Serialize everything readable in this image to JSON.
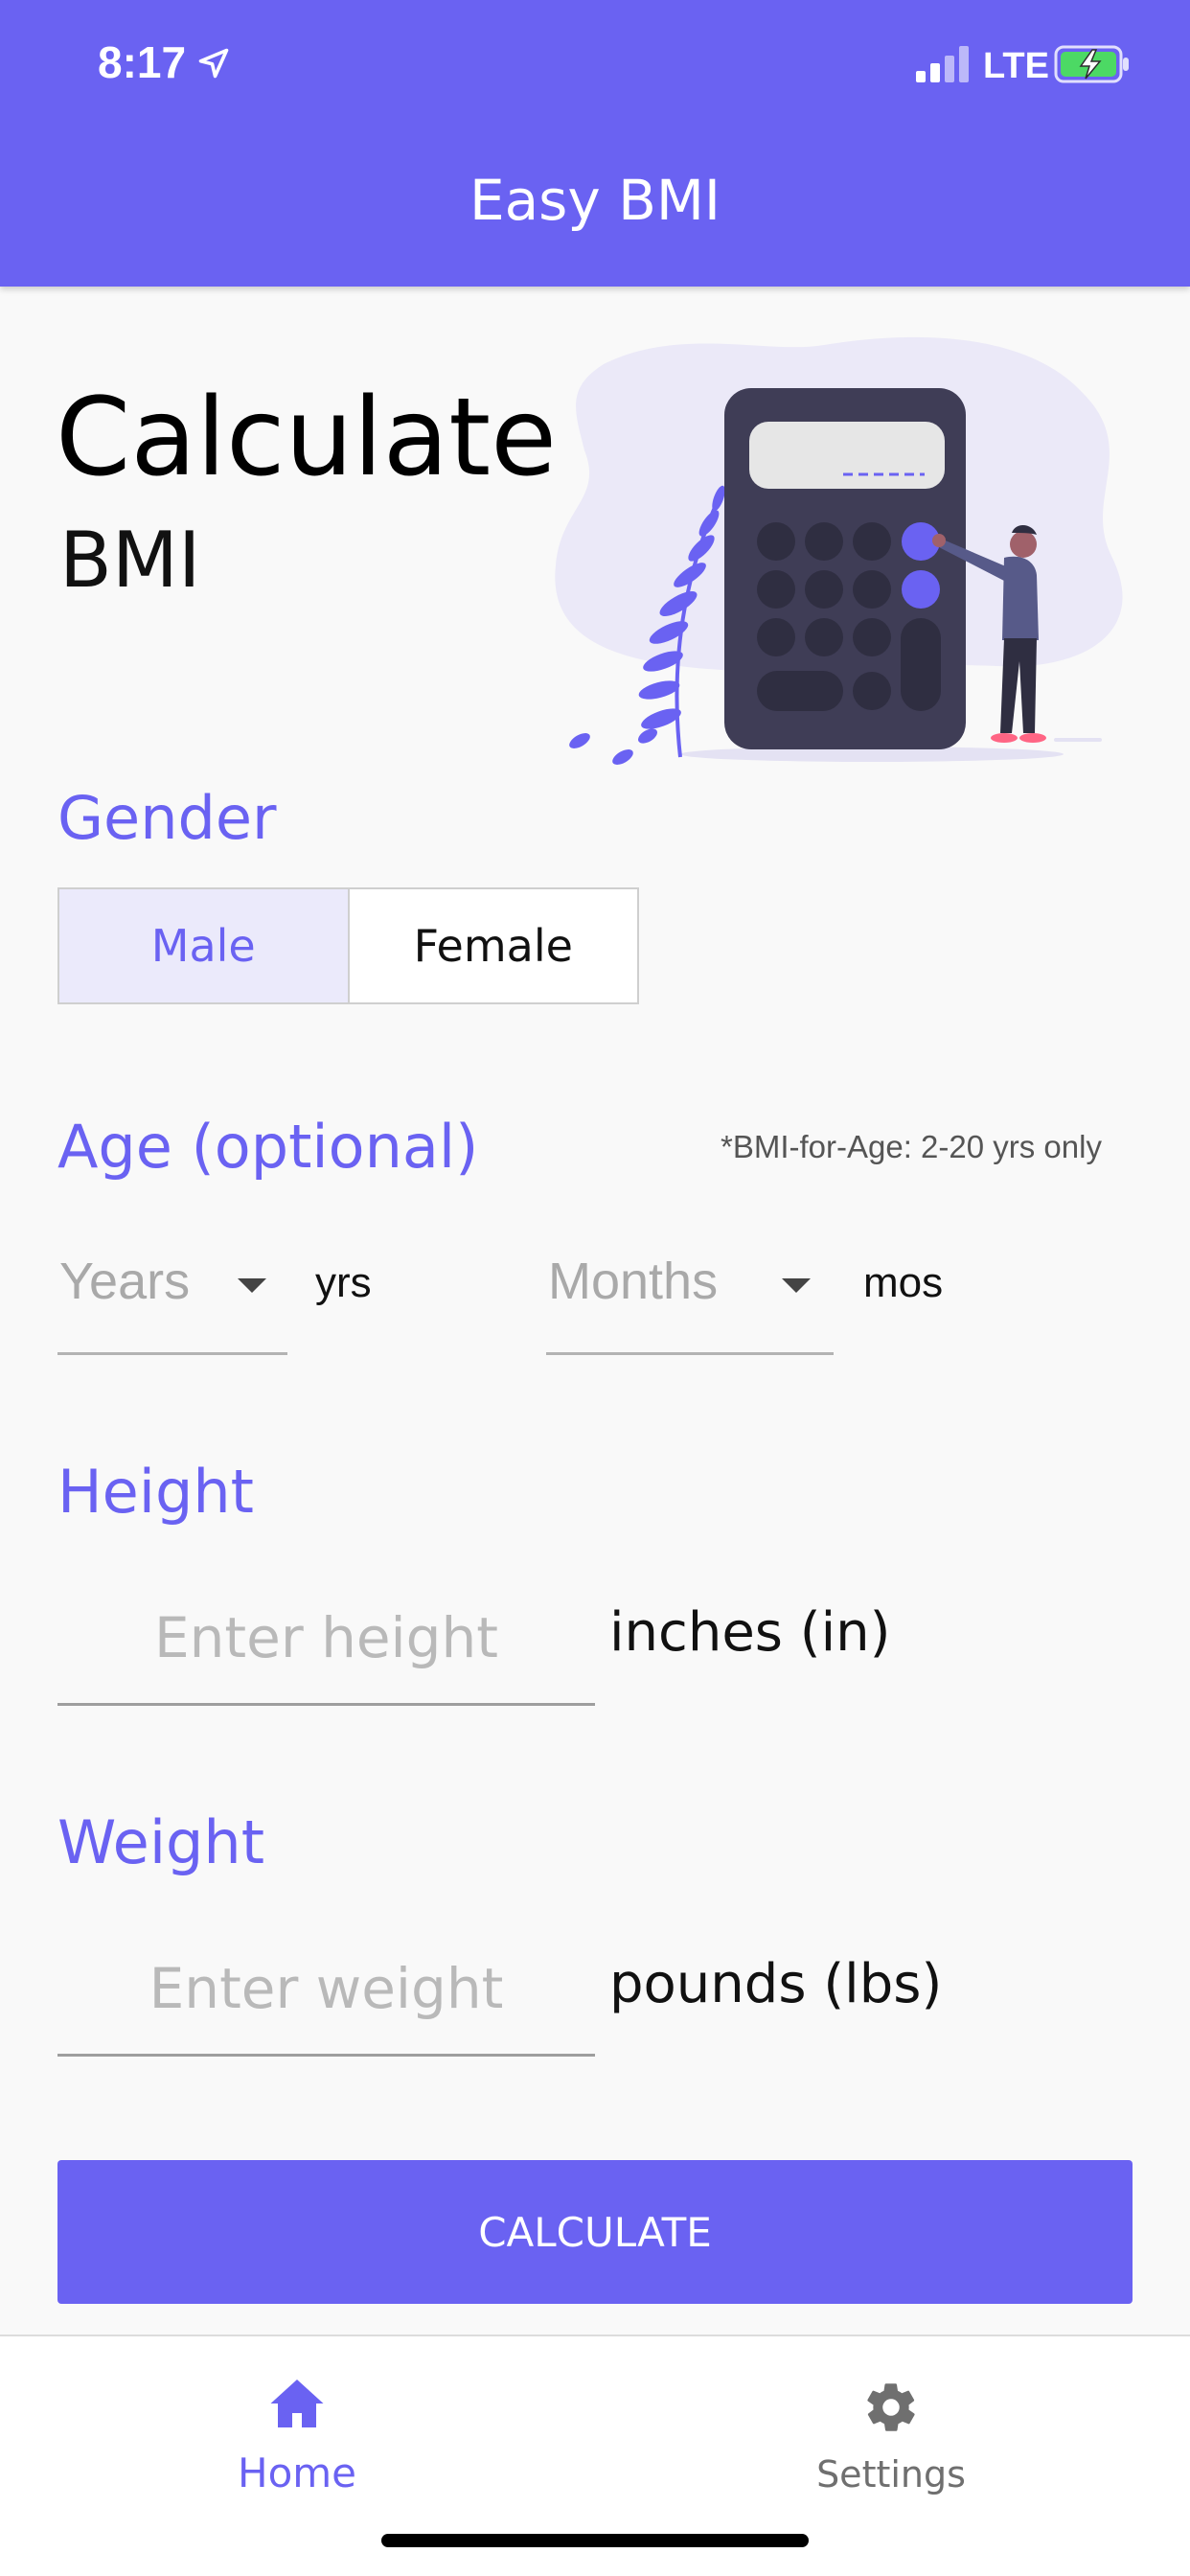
{
  "status_bar": {
    "time": "8:17",
    "network": "LTE",
    "icons": [
      "location-arrow-icon",
      "signal-bars-icon",
      "battery-charging-icon"
    ]
  },
  "header": {
    "title": "Easy BMI"
  },
  "hero": {
    "title": "Calculate",
    "subtitle": "BMI",
    "illustration": "calculator-person-illustration"
  },
  "gender": {
    "label": "Gender",
    "options": [
      "Male",
      "Female"
    ],
    "selected": "Male"
  },
  "age": {
    "label": "Age (optional)",
    "note": "*BMI-for-Age: 2-20 yrs only",
    "years_placeholder": "Years",
    "years_unit": "yrs",
    "months_placeholder": "Months",
    "months_unit": "mos"
  },
  "height": {
    "label": "Height",
    "placeholder": "Enter height",
    "unit": "inches (in)"
  },
  "weight": {
    "label": "Weight",
    "placeholder": "Enter weight",
    "unit": "pounds (lbs)"
  },
  "actions": {
    "calculate_label": "CALCULATE"
  },
  "bottom_nav": {
    "home_label": "Home",
    "settings_label": "Settings",
    "active": "Home"
  },
  "colors": {
    "primary": "#6a62f2",
    "selected_bg": "#ebeafb",
    "background": "#f9f9f9",
    "inactive": "#6f6f6f"
  }
}
